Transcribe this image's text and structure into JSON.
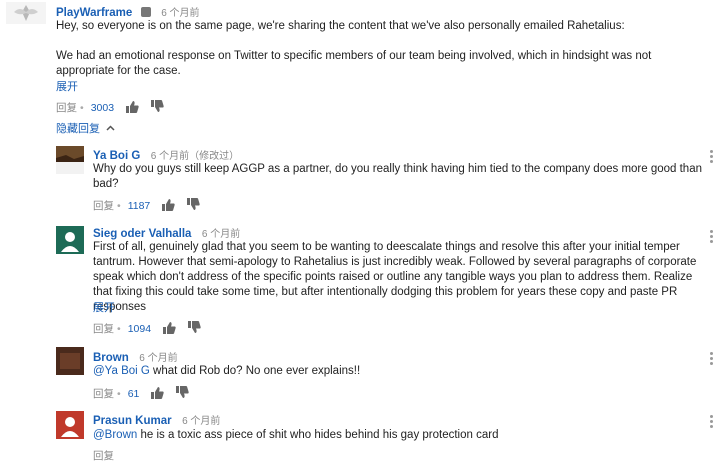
{
  "main_comment": {
    "author": "PlayWarframe",
    "time": "6 个月前",
    "paragraph1": "Hey, so everyone is on the same page, we're sharing the content that we've also personally emailed Rahetalius:",
    "paragraph2": "We had an emotional response on Twitter to specific members of our team being involved, which in hindsight was not appropriate for the case.",
    "expand": "展开",
    "reply_label": "回复",
    "likes": "3003",
    "hide_replies": "隐藏回复"
  },
  "replies": [
    {
      "author": "Ya Boi G",
      "time": "6 个月前（修改过）",
      "text": "Why do you guys still keep AGGP as a partner, do you really think having him tied to the company does more good than bad?",
      "reply_label": "回复",
      "likes": "1187"
    },
    {
      "author": "Sieg oder Valhalla",
      "time": "6 个月前",
      "text": "First of all, genuinely glad that you seem to be wanting to deescalate things and resolve this after your initial temper tantrum.  However that semi-apology to Rahetalius is just incredibly weak.  Followed by several paragraphs of corporate speak which don't address of the specific points raised or outline any tangible ways you plan to address them.  Realize that fixing this could take some time, but after intentionally dodging this problem for years these copy and paste PR responses",
      "expand": "展开",
      "reply_label": "回复",
      "likes": "1094"
    },
    {
      "author": "Brown",
      "time": "6 个月前",
      "mention": "@Ya Boi G",
      "text": " what did Rob do? No one ever explains!!",
      "reply_label": "回复",
      "likes": "61"
    },
    {
      "author": "Prasun Kumar",
      "time": "6 个月前",
      "mention": "@Brown",
      "text": " he is a toxic ass piece of shit who hides behind his gay protection card",
      "reply_label": "回复"
    }
  ],
  "colors": {
    "link": "#1a5fb4",
    "avatar_sieg": "#1d6b56",
    "avatar_brown": "#4a2a1c",
    "avatar_prasun": "#c0392b"
  }
}
